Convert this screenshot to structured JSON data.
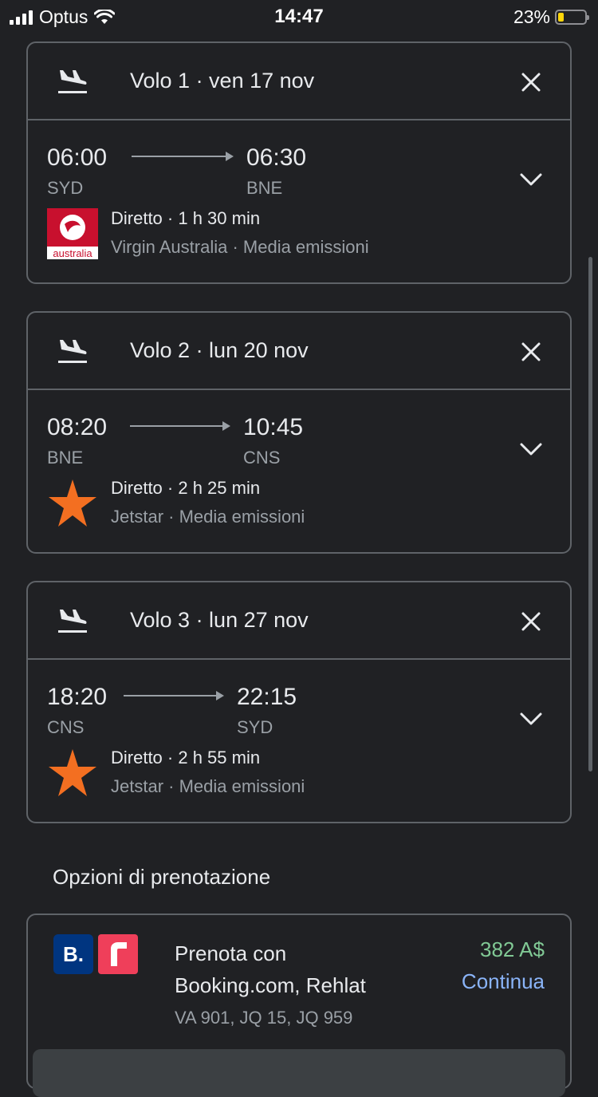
{
  "status_bar": {
    "carrier": "Optus",
    "time": "14:47",
    "battery_percent": "23%",
    "battery_level": 0.23,
    "icons": [
      "signal-icon",
      "wifi-icon",
      "battery-icon"
    ]
  },
  "flights": [
    {
      "title": "Volo 1 · ven 17 nov",
      "depart_time": "06:00",
      "depart_code": "SYD",
      "arrive_time": "06:30",
      "arrive_code": "BNE",
      "summary": "Diretto · 1 h 30 min",
      "airline_line": "Virgin Australia · Media emissioni",
      "logo": "virgin-australia-logo",
      "logo_text": "australia"
    },
    {
      "title": "Volo 2 · lun 20 nov",
      "depart_time": "08:20",
      "depart_code": "BNE",
      "arrive_time": "10:45",
      "arrive_code": "CNS",
      "summary": "Diretto · 2 h 25 min",
      "airline_line": "Jetstar · Media emissioni",
      "logo": "jetstar-star-logo"
    },
    {
      "title": "Volo 3 · lun 27 nov",
      "depart_time": "18:20",
      "depart_code": "CNS",
      "arrive_time": "22:15",
      "arrive_code": "SYD",
      "summary": "Diretto · 2 h 55 min",
      "airline_line": "Jetstar · Media emissioni",
      "logo": "jetstar-star-logo"
    }
  ],
  "booking": {
    "section_title": "Opzioni di prenotazione",
    "text": "Prenota con Booking.com, Rehlat",
    "flights": "VA 901, JQ 15, JQ 959",
    "price": "382 A$",
    "continue_label": "Continua",
    "booking_logo_text": "B.",
    "colors": {
      "price": "#81c995",
      "link": "#8ab4f8",
      "booking_blue": "#003580",
      "rehlat_red": "#ef3f5a"
    }
  },
  "colors": {
    "background": "#202124",
    "border": "#5f6368",
    "jetstar_orange": "#f36f21",
    "virgin_red": "#c8102e"
  }
}
